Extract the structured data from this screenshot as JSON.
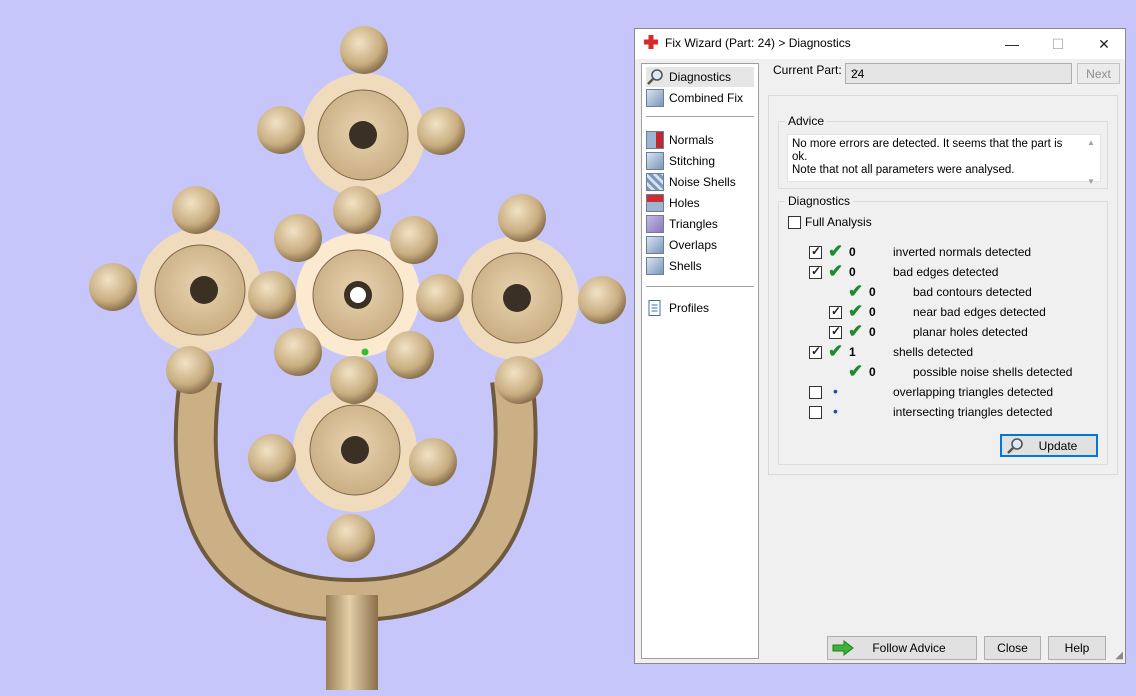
{
  "window": {
    "title": "Fix Wizard (Part: 24) > Diagnostics",
    "minimize": "—",
    "maximize": "☐",
    "close": "✕"
  },
  "nav": {
    "items": [
      {
        "label": "Diagnostics",
        "icon": "magnifier-icon",
        "selected": true
      },
      {
        "label": "Combined Fix",
        "icon": "cube-icon",
        "selected": false
      },
      {
        "label": "Normals",
        "icon": "normals-cube-icon",
        "selected": false
      },
      {
        "label": "Stitching",
        "icon": "stitching-cube-icon",
        "selected": false
      },
      {
        "label": "Noise Shells",
        "icon": "noise-shells-cube-icon",
        "selected": false
      },
      {
        "label": "Holes",
        "icon": "holes-cube-icon",
        "selected": false
      },
      {
        "label": "Triangles",
        "icon": "triangles-cube-icon",
        "selected": false
      },
      {
        "label": "Overlaps",
        "icon": "overlaps-cube-icon",
        "selected": false
      },
      {
        "label": "Shells",
        "icon": "shells-cube-icon",
        "selected": false
      },
      {
        "label": "Profiles",
        "icon": "document-icon",
        "selected": false
      }
    ]
  },
  "current_part": {
    "label": "Current Part:",
    "value": "24",
    "next_button": "Next"
  },
  "advice": {
    "title": "Advice",
    "text_line1": "No more errors are detected. It seems that the part is ok.",
    "text_line2": "Note that not all parameters were analysed."
  },
  "diagnostics": {
    "title": "Diagnostics",
    "full_analysis_label": "Full Analysis",
    "full_analysis_checked": false,
    "rows": [
      {
        "checkbox": true,
        "checked": true,
        "status": "ok",
        "count": "0",
        "label": "inverted normals detected",
        "indent": 0
      },
      {
        "checkbox": true,
        "checked": true,
        "status": "ok",
        "count": "0",
        "label": "bad edges detected",
        "indent": 0
      },
      {
        "checkbox": false,
        "checked": false,
        "status": "ok",
        "count": "0",
        "label": "bad contours detected",
        "indent": 1
      },
      {
        "checkbox": true,
        "checked": true,
        "status": "ok",
        "count": "0",
        "label": "near bad edges detected",
        "indent": 1
      },
      {
        "checkbox": true,
        "checked": true,
        "status": "ok",
        "count": "0",
        "label": "planar holes detected",
        "indent": 1
      },
      {
        "checkbox": true,
        "checked": true,
        "status": "ok",
        "count": "1",
        "label": "shells detected",
        "indent": 0
      },
      {
        "checkbox": false,
        "checked": false,
        "status": "ok",
        "count": "0",
        "label": "possible noise shells detected",
        "indent": 1
      },
      {
        "checkbox": true,
        "checked": false,
        "status": "pending",
        "count": "",
        "label": "overlapping triangles detected",
        "indent": 0
      },
      {
        "checkbox": true,
        "checked": false,
        "status": "pending",
        "count": "",
        "label": "intersecting triangles detected",
        "indent": 0
      }
    ],
    "update_button": "Update"
  },
  "footer": {
    "follow_advice": "Follow Advice",
    "close": "Close",
    "help": "Help"
  },
  "colors": {
    "viewport_bg": "#c6c6fa",
    "part_color": "#cdb690",
    "ok_check": "#1f8a2f"
  }
}
